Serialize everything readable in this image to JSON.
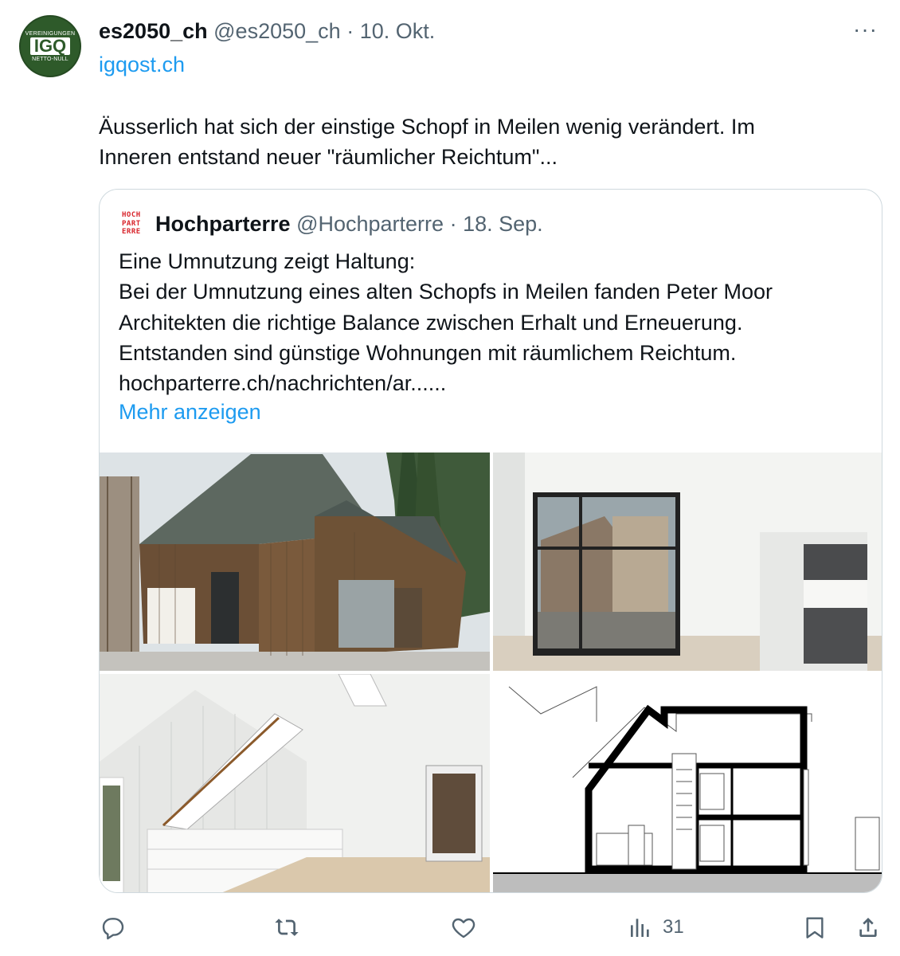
{
  "tweet": {
    "avatar": {
      "top": "VEREINIGUNGEN",
      "mid": "IGQ",
      "bot": "NETTO-NULL"
    },
    "author_name": "es2050_ch",
    "author_handle": "@es2050_ch",
    "separator": "·",
    "date": "10. Okt.",
    "more_label": "···",
    "link": "igqost.ch",
    "text_lines": [
      "Äusserlich hat sich der einstige Schopf in Meilen wenig verändert. Im",
      "Inneren entstand neuer \"räumlicher Reichtum\"..."
    ]
  },
  "quoted": {
    "logo_lines": [
      "HOCH",
      "PART",
      "ERRE"
    ],
    "author_name": "Hochparterre",
    "author_handle": "@Hochparterre",
    "separator": "·",
    "date": "18. Sep.",
    "text_lines": [
      "Eine Umnutzung zeigt Haltung:",
      "Bei der Umnutzung eines alten Schopfs in Meilen fanden Peter Moor",
      "Architekten die richtige Balance zwischen Erhalt und Erneuerung.",
      "Entstanden sind günstige Wohnungen mit räumlichem Reichtum.",
      "hochparterre.ch/nachrichten/ar......"
    ],
    "show_more": "Mehr anzeigen"
  },
  "actions": {
    "reply": {
      "icon": "reply-icon"
    },
    "repost": {
      "icon": "repost-icon"
    },
    "like": {
      "icon": "heart-icon"
    },
    "views": {
      "icon": "views-icon",
      "count": "31"
    },
    "bookmark": {
      "icon": "bookmark-icon"
    },
    "share": {
      "icon": "share-icon"
    }
  },
  "colors": {
    "accent": "#1d9bf0",
    "muted": "#536471",
    "text": "#0f1419",
    "border": "#cfd9de",
    "brand_red": "#d8232a",
    "avatar_green": "#2e5a2a"
  }
}
